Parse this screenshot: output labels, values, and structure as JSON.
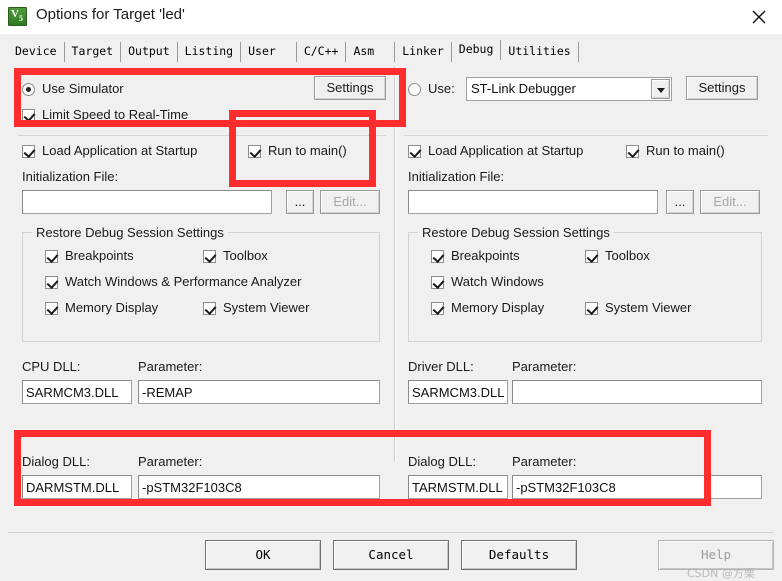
{
  "window": {
    "title": "Options for Target 'led'",
    "icon": "keil-uvision-icon",
    "close_label": "✕"
  },
  "tabs": [
    {
      "label": "Device",
      "selected": false
    },
    {
      "label": "Target",
      "selected": false
    },
    {
      "label": "Output",
      "selected": false
    },
    {
      "label": "Listing",
      "selected": false
    },
    {
      "label": "User",
      "selected": false
    },
    {
      "label": "C/C++",
      "selected": false
    },
    {
      "label": "Asm",
      "selected": false
    },
    {
      "label": "Linker",
      "selected": false
    },
    {
      "label": "Debug",
      "selected": true
    },
    {
      "label": "Utilities",
      "selected": false
    }
  ],
  "left": {
    "use_simulator_label": "Use Simulator",
    "use_simulator_checked": true,
    "settings_label": "Settings",
    "limit_speed_label": "Limit Speed to Real-Time",
    "limit_speed_checked": true,
    "load_app_label": "Load Application at Startup",
    "load_app_checked": true,
    "run_to_main_label": "Run to main()",
    "run_to_main_checked": true,
    "init_file_label": "Initialization File:",
    "init_file_value": "",
    "browse_label": "...",
    "edit_label": "Edit...",
    "restore_group_title": "Restore Debug Session Settings",
    "restore": [
      {
        "label": "Breakpoints",
        "checked": true
      },
      {
        "label": "Toolbox",
        "checked": true
      },
      {
        "label": "Watch Windows & Performance Analyzer",
        "checked": true
      },
      {
        "label": "Memory Display",
        "checked": true
      },
      {
        "label": "System Viewer",
        "checked": true
      }
    ],
    "cpu_dll_label": "CPU DLL:",
    "cpu_dll_value": "SARMCM3.DLL",
    "cpu_param_label": "Parameter:",
    "cpu_param_value": "-REMAP",
    "dialog_dll_label": "Dialog DLL:",
    "dialog_dll_value": "DARMSTM.DLL",
    "dialog_param_label": "Parameter:",
    "dialog_param_value": "-pSTM32F103C8"
  },
  "right": {
    "use_label": "Use:",
    "use_radio_checked": false,
    "debugger_value": "ST-Link Debugger",
    "settings_label": "Settings",
    "load_app_label": "Load Application at Startup",
    "load_app_checked": true,
    "run_to_main_label": "Run to main()",
    "run_to_main_checked": true,
    "init_file_label": "Initialization File:",
    "init_file_value": "",
    "browse_label": "...",
    "edit_label": "Edit...",
    "restore_group_title": "Restore Debug Session Settings",
    "restore": [
      {
        "label": "Breakpoints",
        "checked": true
      },
      {
        "label": "Toolbox",
        "checked": true
      },
      {
        "label": "Watch Windows",
        "checked": true
      },
      {
        "label": "Memory Display",
        "checked": true
      },
      {
        "label": "System Viewer",
        "checked": true
      }
    ],
    "driver_dll_label": "Driver DLL:",
    "driver_dll_value": "SARMCM3.DLL",
    "driver_param_label": "Parameter:",
    "driver_param_value": "",
    "dialog_dll_label": "Dialog DLL:",
    "dialog_dll_value": "TARMSTM.DLL",
    "dialog_param_label": "Parameter:",
    "dialog_param_value": "-pSTM32F103C8"
  },
  "footer": {
    "ok_label": "OK",
    "cancel_label": "Cancel",
    "defaults_label": "Defaults",
    "help_label": "Help"
  },
  "watermark": {
    "text": "CSDN @方栗"
  },
  "annotation": {
    "color": "#ff2d2d",
    "boxes": 4
  }
}
